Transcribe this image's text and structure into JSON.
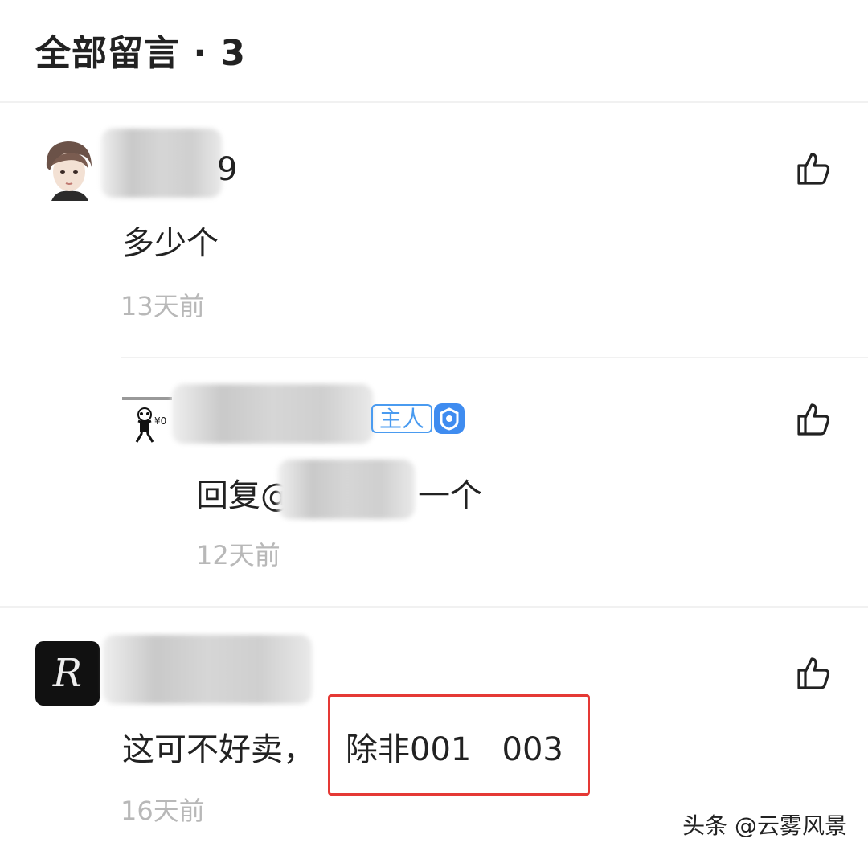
{
  "header": {
    "title": "全部留言 · 3"
  },
  "comments": [
    {
      "username_visible": "9",
      "text": "多少个",
      "time": "13天前",
      "reply": {
        "author_badge": "主人",
        "text_prefix": "回复@",
        "text_suffix": "一个",
        "time": "12天前"
      }
    },
    {
      "avatar_letter": "R",
      "text_prefix": "这可不好卖，",
      "text_highlight": "除非001   003",
      "time": "16天前"
    }
  ],
  "watermark": "头条 @云雾风景",
  "icons": {
    "like": "thumbs-up-icon",
    "badge": "verified-badge-icon"
  },
  "colors": {
    "highlight_border": "#e53935",
    "badge_blue": "#3f8cf0",
    "timestamp": "#b8b8b8"
  }
}
